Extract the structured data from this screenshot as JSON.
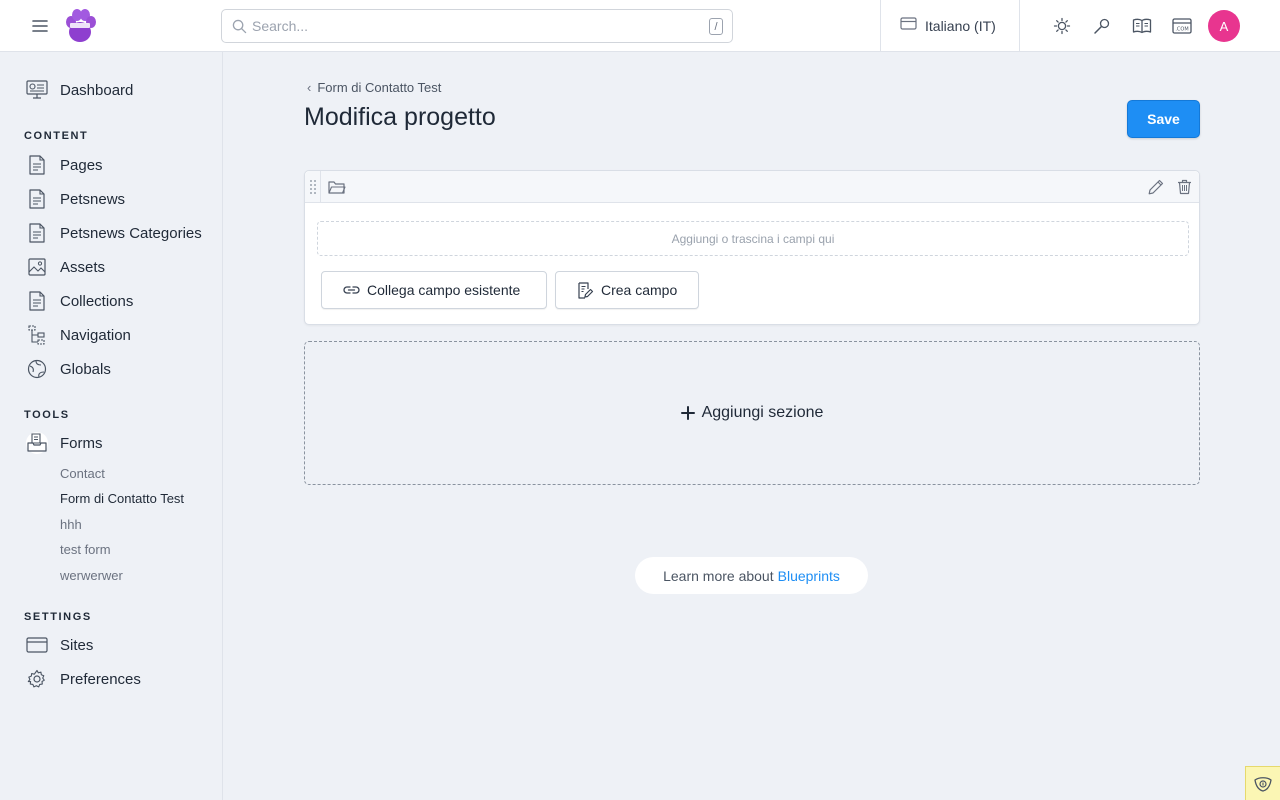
{
  "topbar": {
    "search_placeholder": "Search...",
    "search_shortcut": "/",
    "site_label": "Italiano (IT)",
    "avatar_initial": "A",
    "avatar_color": "#e8358f"
  },
  "sidebar": {
    "dashboard": "Dashboard",
    "content_heading": "CONTENT",
    "content_items": [
      "Pages",
      "Petsnews",
      "Petsnews Categories",
      "Assets",
      "Collections",
      "Navigation",
      "Globals"
    ],
    "tools_heading": "TOOLS",
    "forms_label": "Forms",
    "forms_children": [
      "Contact",
      "Form di Contatto Test",
      "hhh",
      "test form",
      "werwerwer"
    ],
    "forms_active_child": "Form di Contatto Test",
    "settings_heading": "SETTINGS",
    "settings_items": [
      "Sites",
      "Preferences"
    ]
  },
  "main": {
    "breadcrumb": "Form di Contatto Test",
    "title": "Modifica progetto",
    "save_label": "Save",
    "dropzone_text": "Aggiungi o trascina i campi qui",
    "link_field_label": "Collega campo esistente",
    "create_field_label": "Crea campo",
    "add_section_label": "Aggiungi sezione",
    "learn_more_prefix": "Learn more about",
    "learn_more_link": "Blueprints"
  },
  "colors": {
    "accent": "#1e8ef4",
    "background": "#eef1f6"
  }
}
